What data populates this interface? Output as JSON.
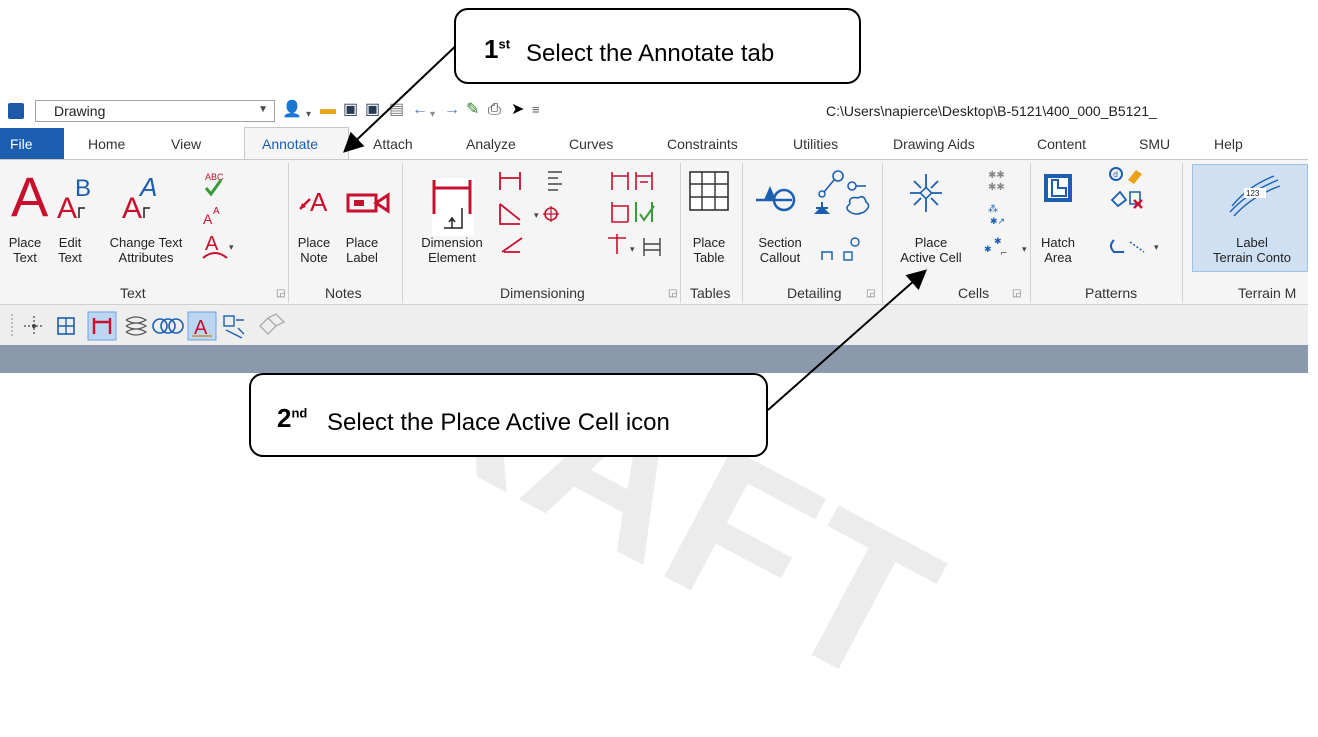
{
  "watermark": "DRAFT",
  "app": {
    "workspace_combo": "Drawing",
    "file_path": "C:\\Users\\napierce\\Desktop\\B-5121\\400_000_B5121_"
  },
  "tabs": {
    "file": "File",
    "items": [
      "Home",
      "View",
      "Annotate",
      "Attach",
      "Analyze",
      "Curves",
      "Constraints",
      "Utilities",
      "Drawing Aids",
      "Content",
      "SMU",
      "Help"
    ],
    "active": "Annotate"
  },
  "ribbon": {
    "text_group": {
      "label": "Text",
      "place_text": [
        "Place",
        "Text"
      ],
      "edit_text": [
        "Edit",
        "Text"
      ],
      "change_text_attributes": [
        "Change Text",
        "Attributes"
      ]
    },
    "notes_group": {
      "label": "Notes",
      "place_note": [
        "Place",
        "Note"
      ],
      "place_label": [
        "Place",
        "Label"
      ]
    },
    "dimensioning_group": {
      "label": "Dimensioning",
      "dimension_element": [
        "Dimension",
        "Element"
      ]
    },
    "tables_group": {
      "label": "Tables",
      "place_table": [
        "Place",
        "Table"
      ]
    },
    "detailing_group": {
      "label": "Detailing",
      "section_callout": [
        "Section",
        "Callout"
      ]
    },
    "cells_group": {
      "label": "Cells",
      "place_active_cell": [
        "Place",
        "Active Cell"
      ]
    },
    "patterns_group": {
      "label": "Patterns",
      "hatch_area": [
        "Hatch",
        "Area"
      ]
    },
    "terrain_group": {
      "label": "Terrain M",
      "label_terrain_contours": [
        "Label",
        "Terrain Conto"
      ]
    }
  },
  "callouts": {
    "first": {
      "ordinal": "1",
      "suffix": "st",
      "text": "Select the Annotate tab"
    },
    "second": {
      "ordinal": "2",
      "suffix": "nd",
      "text": "Select the Place Active Cell icon"
    }
  },
  "colors": {
    "accent": "#1c5fb0",
    "text_red": "#c8102e",
    "status": "#8a99ab"
  }
}
